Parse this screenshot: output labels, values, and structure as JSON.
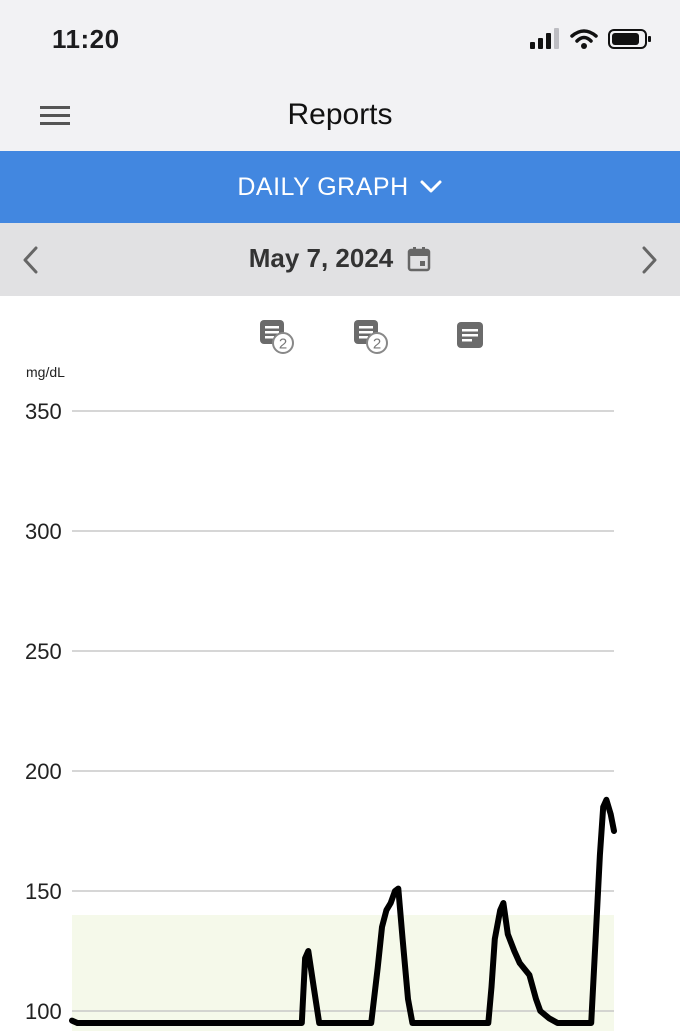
{
  "status_bar": {
    "time": "11:20",
    "icons": [
      "signal-icon",
      "wifi-icon",
      "battery-icon"
    ]
  },
  "nav": {
    "title": "Reports",
    "menu_icon": "hamburger-menu-icon"
  },
  "report_selector": {
    "label": "DAILY GRAPH",
    "icon": "chevron-down-icon"
  },
  "date_nav": {
    "date": "May 7, 2024",
    "prev_icon": "chevron-left-icon",
    "next_icon": "chevron-right-icon",
    "calendar_icon": "calendar-icon"
  },
  "notes": [
    {
      "icon": "note-icon",
      "count": "2"
    },
    {
      "icon": "note-icon",
      "count": "2"
    },
    {
      "icon": "note-icon",
      "count": ""
    }
  ],
  "colors": {
    "accent": "#4287e0",
    "target_range": "#f5f9ea",
    "line": "#000000",
    "gridline": "#c8c8c8"
  },
  "chart_data": {
    "type": "line",
    "unit": "mg/dL",
    "ylabel": "mg/dL",
    "yticks": [
      100,
      150,
      200,
      250,
      300,
      350
    ],
    "ylim": [
      95,
      352
    ],
    "xlim": [
      0,
      100
    ],
    "target_range": [
      70,
      140
    ],
    "grid": true,
    "series": [
      {
        "values": [
          [
            0,
            96
          ],
          [
            1,
            95
          ],
          [
            42.4,
            95
          ],
          [
            43,
            122
          ],
          [
            43.6,
            125
          ],
          [
            44.6,
            110
          ],
          [
            45.6,
            95
          ],
          [
            47.2,
            95
          ],
          [
            47.8,
            95
          ],
          [
            55.2,
            95
          ],
          [
            56.4,
            118
          ],
          [
            57.2,
            135
          ],
          [
            58,
            142
          ],
          [
            58.8,
            145
          ],
          [
            59.6,
            150
          ],
          [
            60.2,
            151
          ],
          [
            61,
            130
          ],
          [
            62,
            105
          ],
          [
            62.8,
            95
          ],
          [
            76.8,
            95
          ],
          [
            77.4,
            110
          ],
          [
            78,
            130
          ],
          [
            79,
            142
          ],
          [
            79.6,
            145
          ],
          [
            80.4,
            132
          ],
          [
            81.6,
            125
          ],
          [
            82.6,
            120
          ],
          [
            84.4,
            115
          ],
          [
            85.6,
            105
          ],
          [
            86.4,
            100
          ],
          [
            88,
            97
          ],
          [
            89.6,
            95
          ],
          [
            95.8,
            95
          ],
          [
            96.6,
            130
          ],
          [
            97.4,
            165
          ],
          [
            98,
            185
          ],
          [
            98.6,
            188
          ],
          [
            99.4,
            182
          ],
          [
            100,
            175
          ]
        ]
      }
    ]
  }
}
